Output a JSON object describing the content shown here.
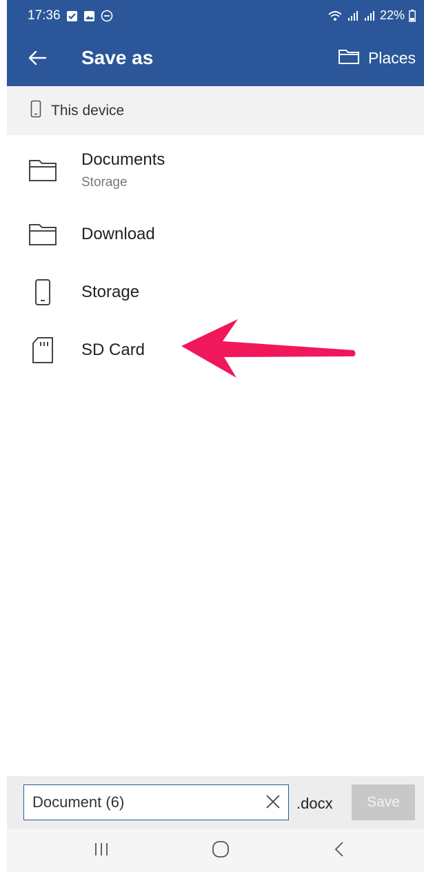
{
  "status_bar": {
    "time": "17:36",
    "battery": "22%",
    "icons": [
      "check-box-icon",
      "image-icon",
      "do-not-disturb-icon",
      "wifi-icon",
      "signal-icon",
      "signal-icon",
      "battery-icon"
    ]
  },
  "app_bar": {
    "title": "Save as",
    "places_label": "Places",
    "color": "#2b579a"
  },
  "location": {
    "label": "This device"
  },
  "folders": [
    {
      "name": "Documents",
      "sub": "Storage",
      "icon": "folder-icon"
    },
    {
      "name": "Download",
      "sub": "",
      "icon": "folder-icon"
    },
    {
      "name": "Storage",
      "sub": "",
      "icon": "phone-icon"
    },
    {
      "name": "SD Card",
      "sub": "",
      "icon": "sd-card-icon"
    }
  ],
  "annotation": {
    "arrow_color": "#f0175b",
    "points_to": "SD Card"
  },
  "bottom_bar": {
    "filename": "Document (6)",
    "extension": ".docx",
    "save_label": "Save"
  },
  "nav_bar": {
    "buttons": [
      "recents-icon",
      "home-icon",
      "back-nav-icon"
    ]
  }
}
